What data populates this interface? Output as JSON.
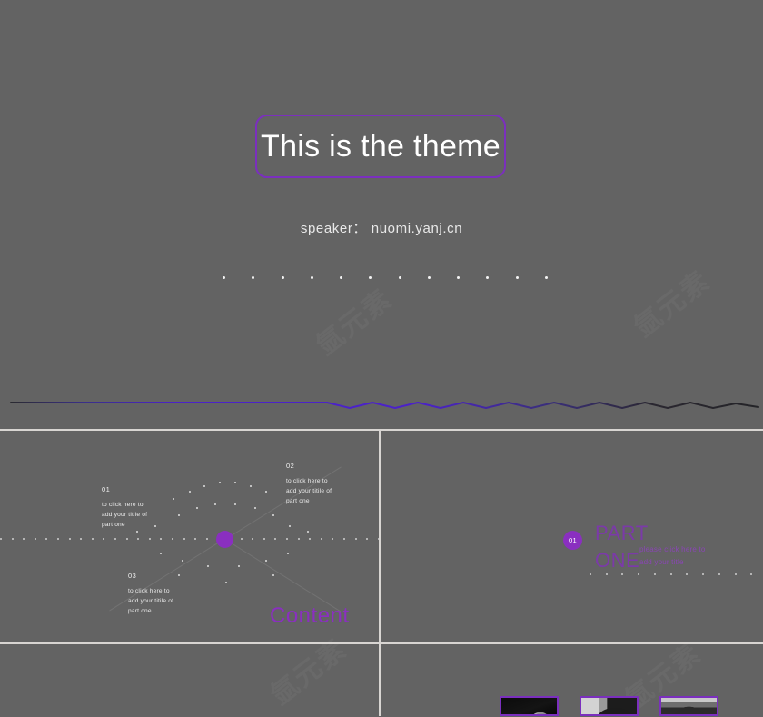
{
  "theme": {
    "background": "#636363",
    "accent_purple": "#8a2fc0",
    "title_border": "#7b2fbe",
    "wave_purple": "#4b22c8",
    "wave_dark": "#23232a",
    "divider": "#d8d5d2"
  },
  "watermark": {
    "text": "氩元素",
    "positions": "repeated diagonal"
  },
  "hero": {
    "title": "This is the theme",
    "speaker_label": "speaker：",
    "speaker_value": "nuomi.yanj.cn",
    "speaker_line": "speaker： nuomi.yanj.cn",
    "dot_count": 12
  },
  "content_slide": {
    "heading": "Content",
    "items": [
      {
        "number": "01",
        "text": "to click here to\nadd your titile of\npart one"
      },
      {
        "number": "02",
        "text": "to click here to\nadd your titile of\npart one"
      },
      {
        "number": "03",
        "text": "to click here to\nadd your titile of\npart one"
      }
    ]
  },
  "part_slide": {
    "badge_number": "01",
    "title": "PART\nONE",
    "subtitle": "please click here to\nadd your title",
    "dot_count": 12
  },
  "photos_slide": {
    "photos": [
      {
        "name": "portrait-1",
        "tone": "dark"
      },
      {
        "name": "portrait-2",
        "tone": "mid"
      },
      {
        "name": "portrait-3",
        "tone": "light"
      }
    ]
  }
}
